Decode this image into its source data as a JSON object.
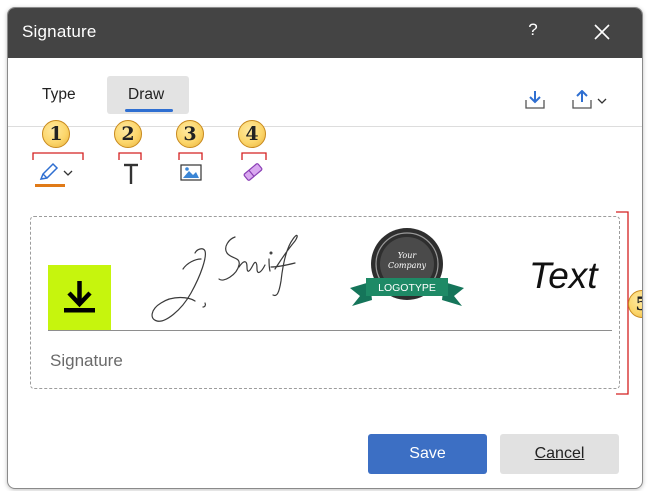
{
  "window": {
    "title": "Signature",
    "help_label": "?"
  },
  "tabs": [
    {
      "label": "Type",
      "selected": false
    },
    {
      "label": "Draw",
      "selected": true
    }
  ],
  "toolbar_header": {
    "import_icon": "download-tray-icon",
    "export_icon": "upload-tray-icon"
  },
  "tools": [
    {
      "badge": "1",
      "icon": "pen-icon",
      "color": "#e07a17"
    },
    {
      "badge": "2",
      "icon": "text-tool-icon"
    },
    {
      "badge": "3",
      "icon": "image-icon"
    },
    {
      "badge": "4",
      "icon": "eraser-icon"
    }
  ],
  "signature_area": {
    "badge": "5",
    "logotype_text": "LOGOTYPE",
    "seal_text_line1": "Your",
    "seal_text_line2": "Company",
    "text_sample": "Text",
    "line_label": "Signature"
  },
  "footer": {
    "save_label": "Save",
    "cancel_label": "Cancel"
  },
  "colors": {
    "titlebar": "#444444",
    "accent_blue": "#3c6fc4",
    "logo_green": "#c6f50d",
    "ribbon_teal": "#1e8a66"
  }
}
